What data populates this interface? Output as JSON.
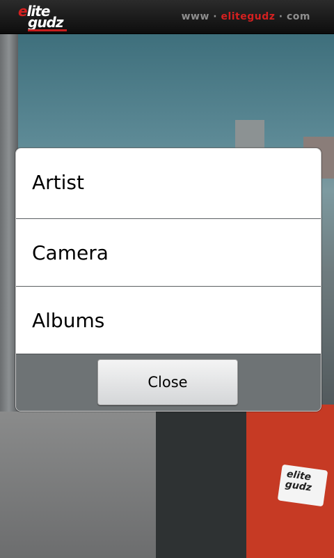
{
  "header": {
    "logo_line1_e": "e",
    "logo_line1_rest": "lite",
    "logo_line2": "gudz",
    "url_prefix": "www · ",
    "url_brand": "elitegudz",
    "url_suffix": " · com"
  },
  "dialog": {
    "items": [
      {
        "label": "Artist"
      },
      {
        "label": "Camera"
      },
      {
        "label": "Albums"
      }
    ],
    "close_label": "Close"
  },
  "background": {
    "sticker_line1": "elite",
    "sticker_line2": "gudz"
  },
  "colors": {
    "brand_red": "#d42020",
    "dialog_footer": "#6e7375"
  }
}
